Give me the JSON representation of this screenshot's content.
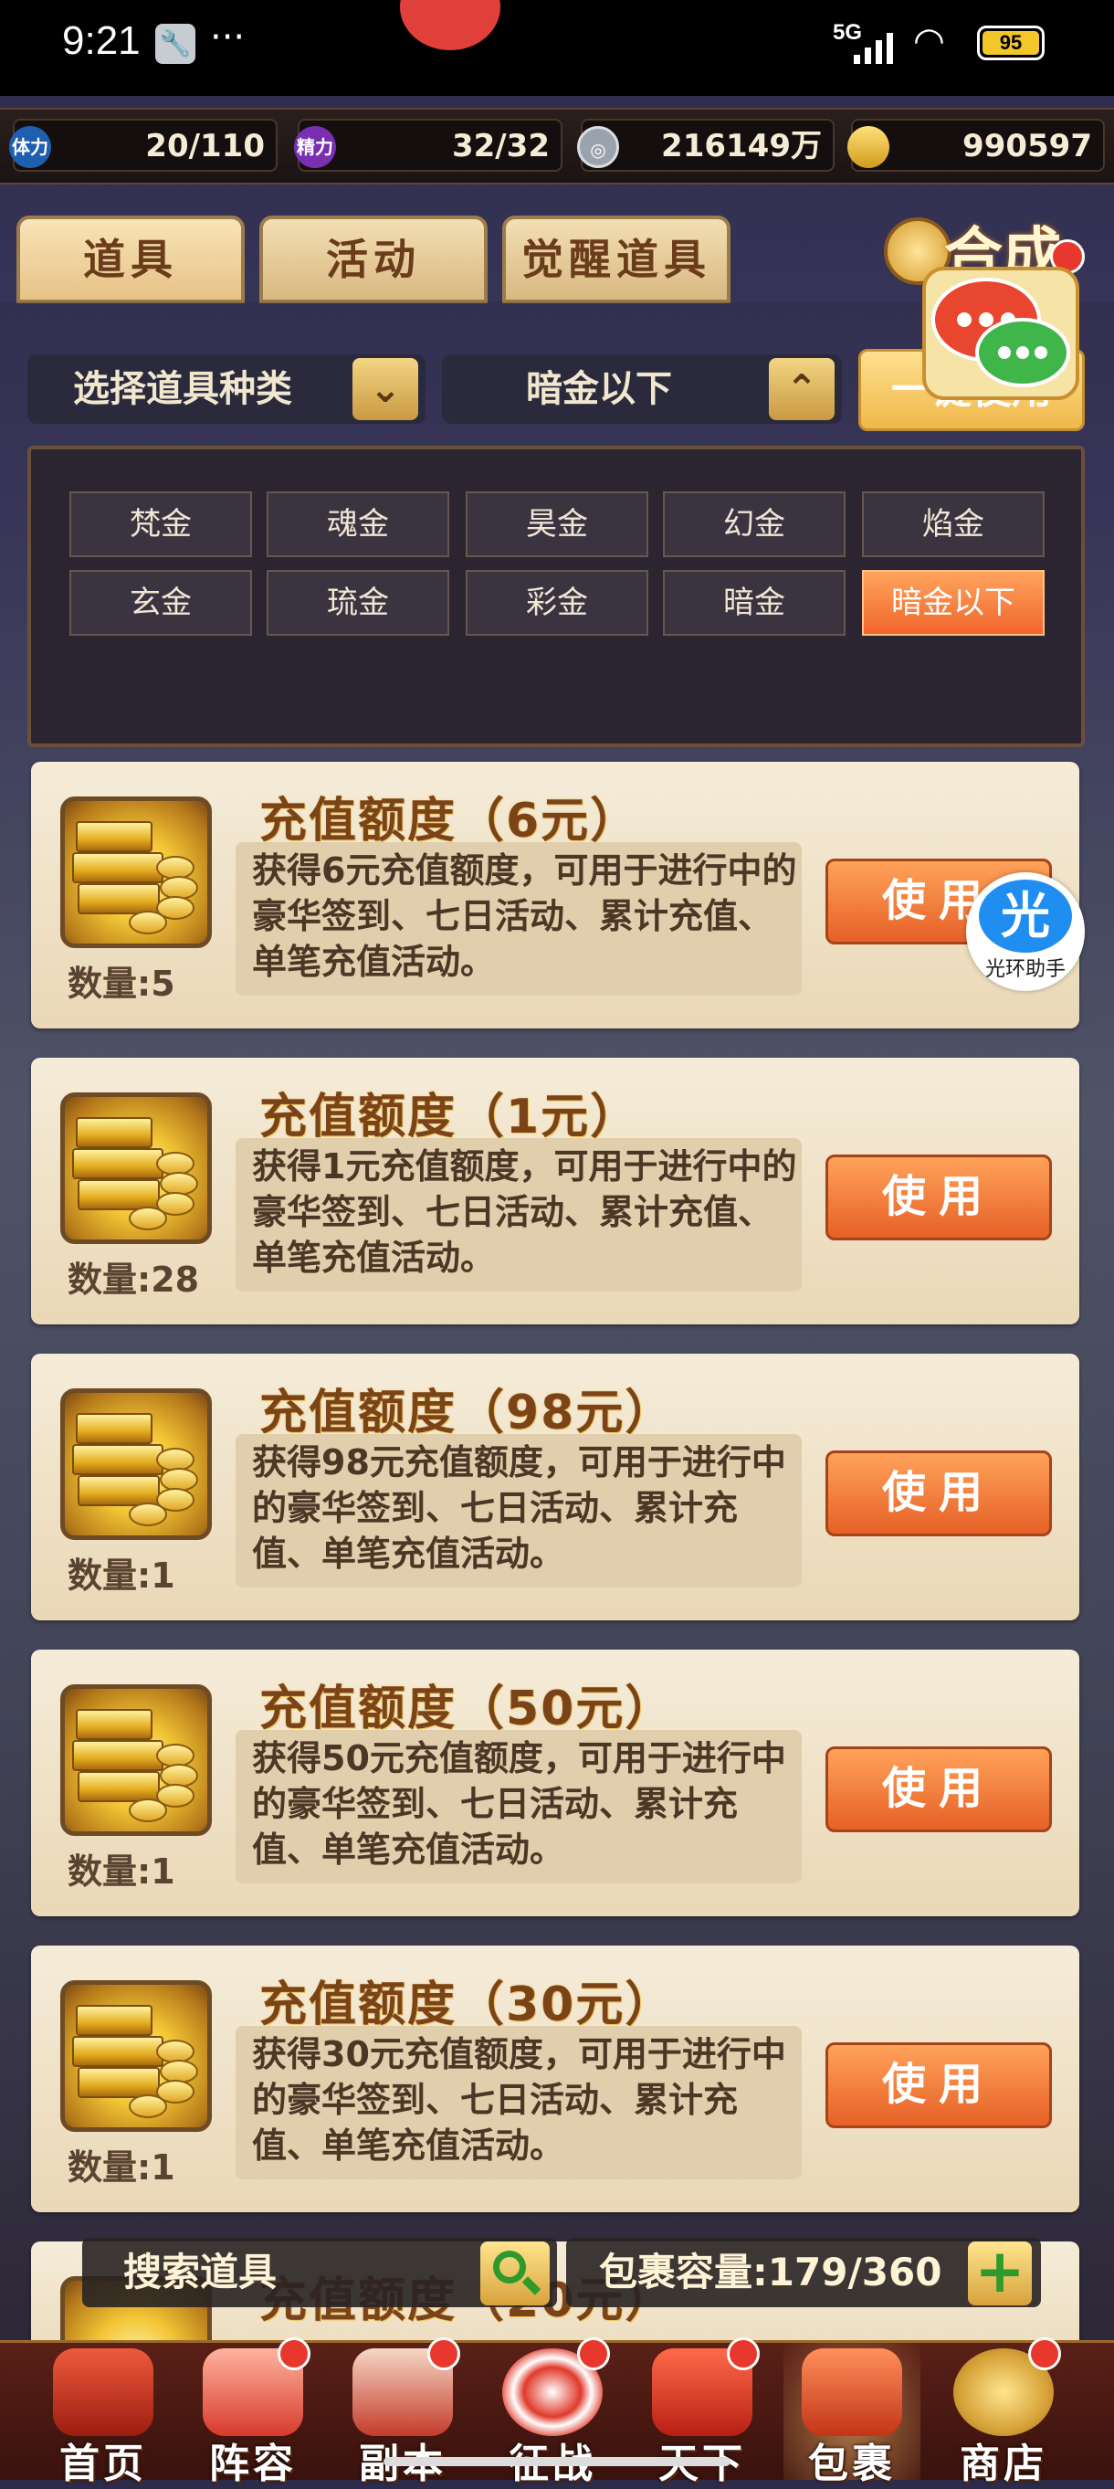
{
  "status_bar": {
    "time": "9:21",
    "network": "5G",
    "battery": "95"
  },
  "resources": {
    "stamina_label": "体力",
    "stamina": "20/110",
    "energy_label": "精力",
    "energy": "32/32",
    "coins": "216149万",
    "ingots": "990597"
  },
  "tabs": [
    "道具",
    "活动",
    "觉醒道具"
  ],
  "synthesis_label": "合成",
  "filter": {
    "type_dropdown": "选择道具种类",
    "grade_dropdown": "暗金以下",
    "use_all_label": "一键使用",
    "options": [
      "梵金",
      "魂金",
      "昊金",
      "幻金",
      "焰金",
      "玄金",
      "琉金",
      "彩金",
      "暗金",
      "暗金以下"
    ],
    "selected": "暗金以下"
  },
  "items": [
    {
      "title": "充值额度（6元）",
      "qty": "数量:5",
      "desc": "获得6元充值额度，可用于进行中的豪华签到、七日活动、累计充值、单笔充值活动。",
      "button": "使用"
    },
    {
      "title": "充值额度（1元）",
      "qty": "数量:28",
      "desc": "获得1元充值额度，可用于进行中的豪华签到、七日活动、累计充值、单笔充值活动。",
      "button": "使用"
    },
    {
      "title": "充值额度（98元）",
      "qty": "数量:1",
      "desc": "获得98元充值额度，可用于进行中的豪华签到、七日活动、累计充值、单笔充值活动。",
      "button": "使用"
    },
    {
      "title": "充值额度（50元）",
      "qty": "数量:1",
      "desc": "获得50元充值额度，可用于进行中的豪华签到、七日活动、累计充值、单笔充值活动。",
      "button": "使用"
    },
    {
      "title": "充值额度（30元）",
      "qty": "数量:1",
      "desc": "获得30元充值额度，可用于进行中的豪华签到、七日活动、累计充值、单笔充值活动。",
      "button": "使用"
    },
    {
      "title": "充值额度（20元）",
      "qty": "",
      "desc": "",
      "button": ""
    }
  ],
  "assistant_label": "光环助手",
  "assistant_glyph": "光",
  "search_placeholder": "搜索道具",
  "capacity": "包裹容量:179/360",
  "nav": [
    "首页",
    "阵容",
    "副本",
    "征战",
    "天下",
    "包裹",
    "商店"
  ],
  "colors": {
    "accent_orange": "#e66127",
    "card_bg": "#f5ecd9",
    "title_brown": "#7a4418",
    "notification_red": "#e8382d"
  }
}
